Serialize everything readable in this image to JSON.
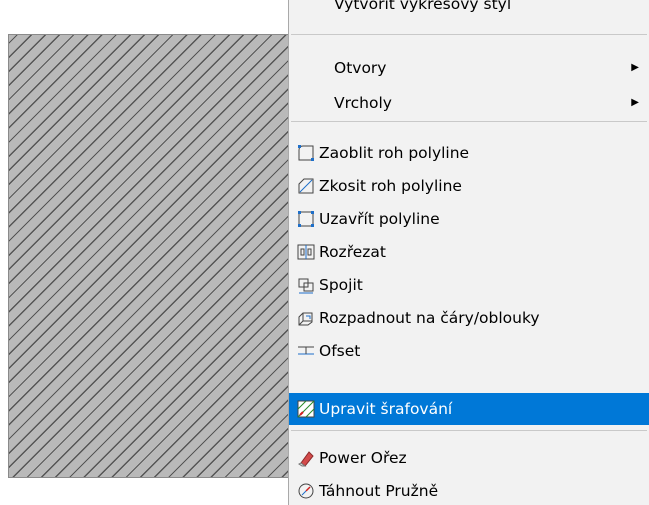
{
  "menu": {
    "items": [
      {
        "label": "Vytvořit výkresový styl",
        "icon": "",
        "submenu": false
      },
      {
        "label": "Otvory",
        "icon": "",
        "submenu": true
      },
      {
        "label": "Vrcholy",
        "icon": "",
        "submenu": true
      },
      {
        "label": "Zaoblit roh polyline",
        "icon": "fillet-polyline-icon",
        "submenu": false
      },
      {
        "label": "Zkosit roh polyline",
        "icon": "chamfer-polyline-icon",
        "submenu": false
      },
      {
        "label": "Uzavřít polyline",
        "icon": "close-polyline-icon",
        "submenu": false
      },
      {
        "label": "Rozřezat",
        "icon": "split-icon",
        "submenu": false
      },
      {
        "label": "Spojit",
        "icon": "join-icon",
        "submenu": false
      },
      {
        "label": "Rozpadnout na čáry/oblouky",
        "icon": "explode-icon",
        "submenu": false
      },
      {
        "label": "Ofset",
        "icon": "offset-icon",
        "submenu": false
      },
      {
        "label": "Upravit šrafování",
        "icon": "edit-hatch-icon",
        "submenu": false,
        "highlighted": true
      },
      {
        "label": "Power Ořez",
        "icon": "power-trim-icon",
        "submenu": false
      },
      {
        "label": "Táhnout Pružně",
        "icon": "stretch-dynamic-icon",
        "submenu": false
      }
    ],
    "submenu_arrow": "▶"
  },
  "colors": {
    "highlight": "#0078d7",
    "menu_bg": "#f2f2f2",
    "hatch_bg": "#b9b9b9"
  }
}
